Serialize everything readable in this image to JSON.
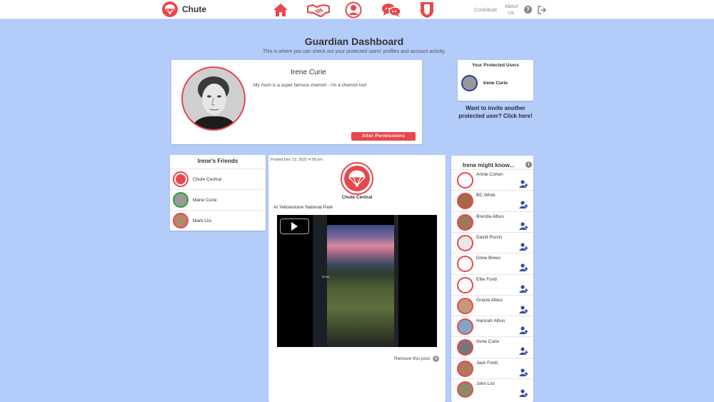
{
  "colors": {
    "accent": "#e8474c",
    "background": "#b3ccf9",
    "protected_border": "#2a3aa8",
    "friend_border_green": "#2e9e38"
  },
  "topbar": {
    "brand": "Chute",
    "nav_icons": [
      "home-icon",
      "handshake-icon",
      "profile-icon",
      "messages-icon",
      "shield-icon"
    ],
    "contribute": "Contribute",
    "about": "About Us",
    "help_glyph": "?",
    "logout_icon": "logout-icon"
  },
  "header": {
    "title": "Guardian Dashboard",
    "subtitle": "This is where you can check out your protected users' profiles and account activity."
  },
  "profile": {
    "name": "Irene Curie",
    "bio": "My mom is a super famous chemist - I'm a chemist too!",
    "alter_button": "Alter Permissions"
  },
  "protected_users": {
    "title": "Your Protected Users",
    "users": [
      {
        "name": "Irene Curie"
      }
    ],
    "invite_link": "Want to invite another protected user? Click here!"
  },
  "friends": {
    "title": "Irene's Friends",
    "items": [
      {
        "name": "Chute  Central"
      },
      {
        "name": "Marie Curie"
      },
      {
        "name": "Mark Lisi"
      }
    ]
  },
  "post": {
    "timestamp": "Posted Dec 13, 2021 4:28 pm",
    "author": "Chute  Central",
    "location": "At Yellowstone National Park",
    "video_watermark": "TikTok",
    "remove_label": "Remove this post",
    "remove_glyph": "i"
  },
  "suggestions": {
    "title": "Irene might know...",
    "info_glyph": "i",
    "people": [
      {
        "name": "Annie  Cohen"
      },
      {
        "name": "BC Winik"
      },
      {
        "name": "Brenda Albus"
      },
      {
        "name": "David Purvis"
      },
      {
        "name": "Drew Brees"
      },
      {
        "name": "Ellie Fordi"
      },
      {
        "name": "Gracie Albus"
      },
      {
        "name": "Hannah Albus"
      },
      {
        "name": "Irene Curie"
      },
      {
        "name": "Jack Fordi"
      },
      {
        "name": "John Lisi"
      }
    ]
  }
}
